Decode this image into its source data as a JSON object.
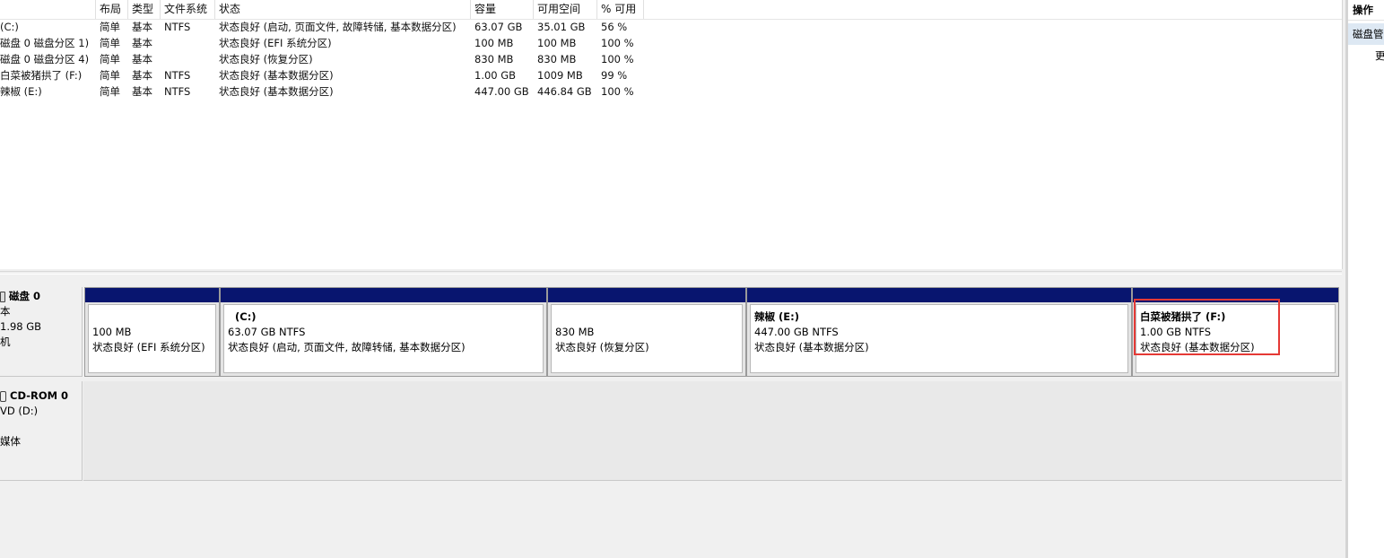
{
  "volume_list": {
    "columns": [
      "",
      "布局",
      "类型",
      "文件系统",
      "状态",
      "容量",
      "可用空间",
      "% 可用"
    ],
    "rows": [
      {
        "volume": "(C:)",
        "layout": "简单",
        "type": "基本",
        "fs": "NTFS",
        "status": "状态良好 (启动, 页面文件, 故障转储, 基本数据分区)",
        "capacity": "63.07 GB",
        "free": "35.01 GB",
        "pct_free": "56 %"
      },
      {
        "volume": "磁盘 0 磁盘分区 1)",
        "layout": "简单",
        "type": "基本",
        "fs": "",
        "status": "状态良好 (EFI 系统分区)",
        "capacity": "100 MB",
        "free": "100 MB",
        "pct_free": "100 %"
      },
      {
        "volume": "磁盘 0 磁盘分区 4)",
        "layout": "简单",
        "type": "基本",
        "fs": "",
        "status": "状态良好 (恢复分区)",
        "capacity": "830 MB",
        "free": "830 MB",
        "pct_free": "100 %"
      },
      {
        "volume": "白菜被猪拱了 (F:)",
        "layout": "简单",
        "type": "基本",
        "fs": "NTFS",
        "status": "状态良好 (基本数据分区)",
        "capacity": "1.00 GB",
        "free": "1009 MB",
        "pct_free": "99 %"
      },
      {
        "volume": "辣椒 (E:)",
        "layout": "简单",
        "type": "基本",
        "fs": "NTFS",
        "status": "状态良好 (基本数据分区)",
        "capacity": "447.00 GB",
        "free": "446.84 GB",
        "pct_free": "100 %"
      }
    ]
  },
  "disk0": {
    "title": "磁盘 0",
    "line1": "本",
    "line2": "1.98 GB",
    "line3": "机",
    "partitions": [
      {
        "name": "",
        "size": "100 MB",
        "status": "状态良好 (EFI 系统分区)"
      },
      {
        "name": "(C:)",
        "size": "63.07 GB NTFS",
        "status": "状态良好 (启动, 页面文件, 故障转储, 基本数据分区)"
      },
      {
        "name": "",
        "size": "830 MB",
        "status": "状态良好 (恢复分区)"
      },
      {
        "name": "辣椒  (E:)",
        "size": "447.00 GB NTFS",
        "status": "状态良好 (基本数据分区)"
      },
      {
        "name": "白菜被猪拱了  (F:)",
        "size": "1.00 GB NTFS",
        "status": "状态良好 (基本数据分区)"
      }
    ]
  },
  "cdrom0": {
    "title": "CD-ROM 0",
    "line1": "VD (D:)",
    "line2": "媒体"
  },
  "actions": {
    "header": "操作",
    "selected": "磁盘管",
    "item": "更"
  },
  "colors": {
    "partition_bar": "#08156f",
    "highlight": "#e53935",
    "action_selected": "#dde8f3"
  }
}
